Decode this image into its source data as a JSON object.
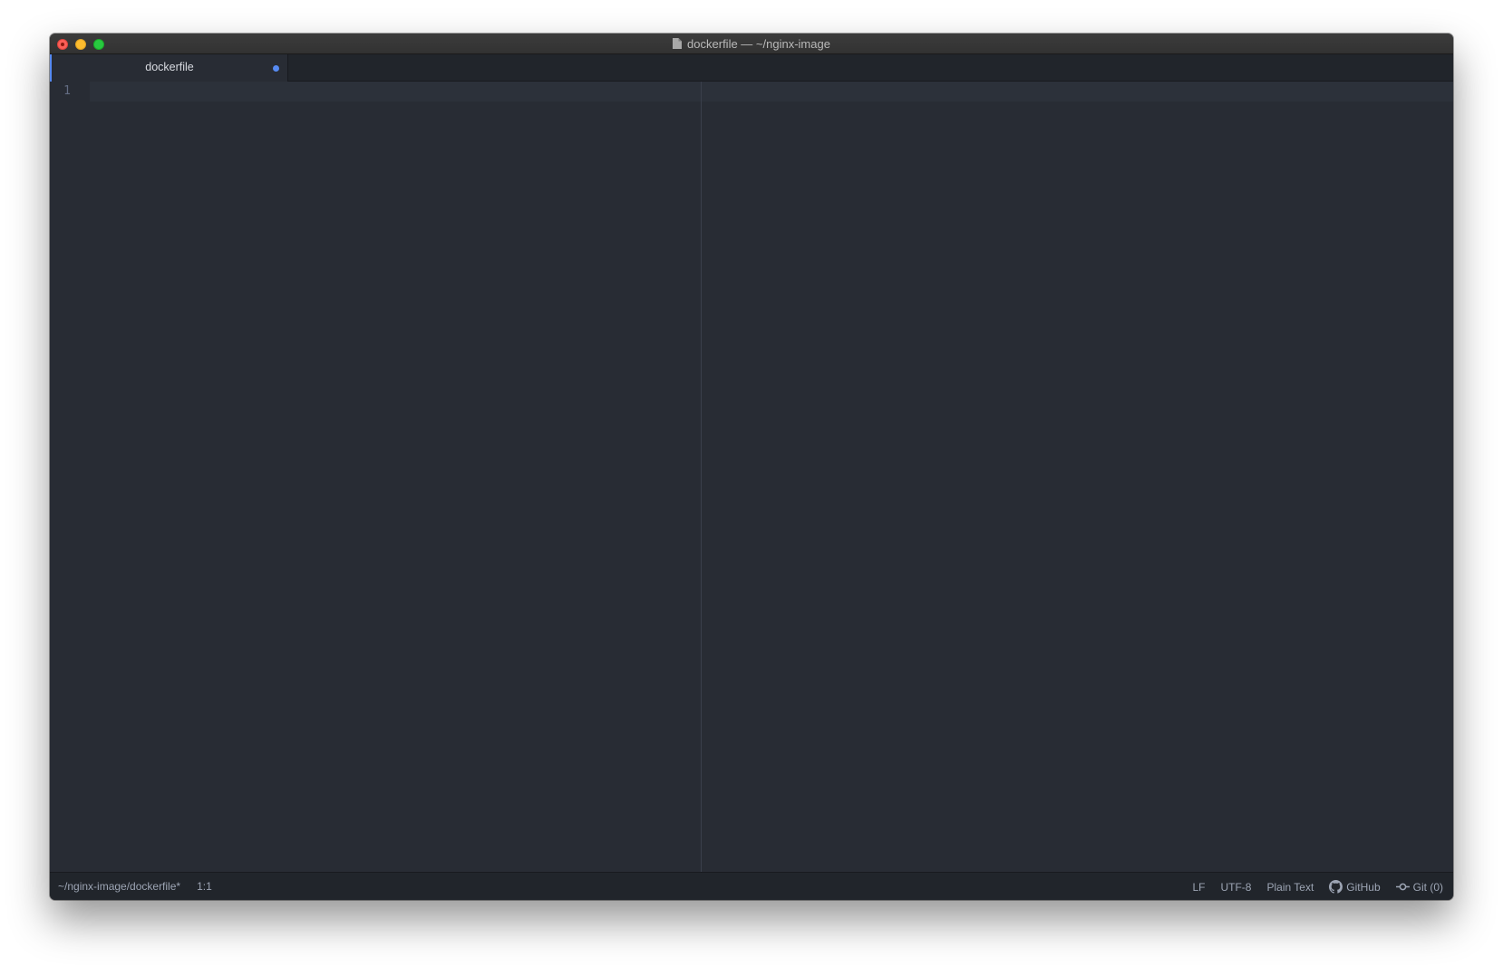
{
  "window": {
    "title": "dockerfile — ~/nginx-image",
    "title_icon": "document-icon"
  },
  "tabs": [
    {
      "label": "dockerfile",
      "modified": true
    }
  ],
  "editor": {
    "line_numbers": [
      "1"
    ],
    "content": ""
  },
  "statusbar": {
    "file_path": "~/nginx-image/dockerfile*",
    "cursor_position": "1:1",
    "line_ending": "LF",
    "encoding": "UTF-8",
    "grammar": "Plain Text",
    "github_label": "GitHub",
    "git_label": "Git (0)"
  },
  "colors": {
    "accent": "#568af2",
    "editor_bg": "#282c34",
    "panel_bg": "#21252b"
  }
}
